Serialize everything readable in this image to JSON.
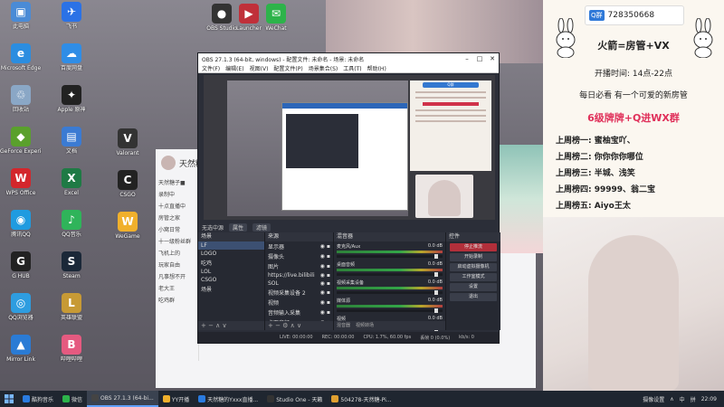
{
  "desktop": {
    "icons": [
      {
        "label": "此电脑",
        "color": "#4a8bd6",
        "glyph": "▣"
      },
      {
        "label": "Microsoft Edge",
        "color": "#2b8de0",
        "glyph": "e"
      },
      {
        "label": "回收站",
        "color": "#8aa7c6",
        "glyph": "♲"
      },
      {
        "label": "GeForce Experience",
        "color": "#5aa02c",
        "glyph": "◆"
      },
      {
        "label": "WPS Office",
        "color": "#d3262c",
        "glyph": "W"
      },
      {
        "label": "腾讯QQ",
        "color": "#1f9be0",
        "glyph": "◉"
      },
      {
        "label": "G HUB",
        "color": "#222",
        "glyph": "G"
      },
      {
        "label": "QQ浏览器",
        "color": "#2e9de0",
        "glyph": "◎"
      },
      {
        "label": "Mirror Link",
        "color": "#2a7bd5",
        "glyph": "▲"
      },
      {
        "label": "飞书",
        "color": "#2b72e6",
        "glyph": "✈"
      },
      {
        "label": "百度网盘",
        "color": "#2f8de6",
        "glyph": "☁"
      },
      {
        "label": "Apple 原神",
        "color": "#222",
        "glyph": "✦"
      },
      {
        "label": "文档",
        "color": "#3b7bd3",
        "glyph": "▤"
      },
      {
        "label": "Excel",
        "color": "#1f7a45",
        "glyph": "X"
      },
      {
        "label": "QQ音乐",
        "color": "#2fb45a",
        "glyph": "♪"
      },
      {
        "label": "Steam",
        "color": "#1b2838",
        "glyph": "S"
      },
      {
        "label": "英雄联盟",
        "color": "#c79a35",
        "glyph": "L"
      },
      {
        "label": "哔哩哔哩",
        "color": "#e55a80",
        "glyph": "B"
      },
      {
        "label": "Valorant",
        "color": "#333",
        "glyph": "V"
      },
      {
        "label": "CSGO",
        "color": "#222",
        "glyph": "C"
      },
      {
        "label": "WeGame",
        "color": "#f0b02c",
        "glyph": "W"
      },
      {
        "label": "OBS Studio",
        "color": "#333",
        "glyph": "●"
      },
      {
        "label": "Launcher",
        "color": "#c0303a",
        "glyph": "▶"
      },
      {
        "label": "WeChat",
        "color": "#2db34a",
        "glyph": "✉"
      }
    ]
  },
  "bgapp": {
    "title": "天然糖",
    "items": [
      "天然糖子■",
      "录制中",
      "十点直播中",
      "房管之家",
      "小窝日常",
      "十一级粉丝群",
      "飞机上的",
      "玩家自由",
      "凡事想不开",
      "老大王",
      "吃鸡群"
    ]
  },
  "obs": {
    "title": "OBS 27.1.3 (64-bit, windows) - 配置文件: 未命名 - 场景: 未命名",
    "menu": [
      "文件(F)",
      "编辑(E)",
      "视图(V)",
      "配置文件(P)",
      "场景集合(S)",
      "工具(T)",
      "帮助(H)"
    ],
    "status_row": {
      "label": "无选中源",
      "props": "属性",
      "filters": "滤镜"
    },
    "docks": {
      "scenes": "场景",
      "sources": "来源",
      "mixer": "混音器",
      "transitions": "转场",
      "controls": "控件"
    },
    "scenes": [
      "LF",
      "LOGO",
      "吃鸡",
      "LOL",
      "CSGO",
      "场景"
    ],
    "sources": [
      "显示器",
      "摄像头",
      "图片",
      "https://live.bilibili",
      "SOL",
      "视频采集设备 2",
      "视频",
      "音频输入采集",
      "桌面音频"
    ],
    "mixer": [
      {
        "name": "麦克风/Aux",
        "db": "0.0 dB"
      },
      {
        "name": "桌面音频",
        "db": "0.0 dB"
      },
      {
        "name": "视频采集设备",
        "db": "0.0 dB"
      },
      {
        "name": "媒体源",
        "db": "0.0 dB"
      },
      {
        "name": "视频",
        "db": "0.0 dB"
      }
    ],
    "mixer_tabs": [
      "混音器",
      "视频转场"
    ],
    "controls": [
      {
        "label": "停止推流",
        "red": true
      },
      {
        "label": "开始录制",
        "red": false
      },
      {
        "label": "启动虚拟摄像机",
        "red": false
      },
      {
        "label": "工作室模式",
        "red": false
      },
      {
        "label": "设置",
        "red": false
      },
      {
        "label": "退出",
        "red": false
      }
    ],
    "bottom": {
      "live": "LIVE: 00:00:00",
      "rec": "REC: 00:00:00",
      "cpu": "CPU: 1.7%, 60.00 fps",
      "dropped": "丢帧 0 (0.0%)",
      "kbps": "kb/s: 0"
    }
  },
  "right_panel": {
    "qq_badge": "Q群",
    "qq_number": "728350668",
    "title": "火箭=房管+VX",
    "hours": "开播时间: 14点-22点",
    "daily": "每日必看 有一个可爱的新房管",
    "highlight": "6级牌牌+Q进WX群",
    "ranks": [
      "上周榜一: 蜜柚宝吖、",
      "上周榜二: 你你你你哪位",
      "上周榜三: 半城、浅笑",
      "上周榜四: 99999、翁二宝",
      "上周榜五: Aiyo王太"
    ]
  },
  "taskbar": {
    "items": [
      {
        "label": "酷狗音乐",
        "color": "#2a7be0",
        "active": false
      },
      {
        "label": "微信",
        "color": "#2db34a",
        "active": false
      },
      {
        "label": "OBS 27.1.3 (64-bi...",
        "color": "#444",
        "active": true
      },
      {
        "label": "YY开播",
        "color": "#f0b02c",
        "active": false
      },
      {
        "label": "天然糖的Yxxx直播...",
        "color": "#2a7be0",
        "active": false
      },
      {
        "label": "Studio One - 天籁",
        "color": "#333",
        "active": false
      },
      {
        "label": "504278-天然糖-Pi...",
        "color": "#e0a030",
        "active": false
      }
    ],
    "tray": [
      "摄像设置",
      "∧",
      "中",
      "拼"
    ],
    "time": "22:09"
  },
  "colors": {
    "accent_red": "#e0305a",
    "obs_bg": "#2b2e38",
    "taskbar": "#1f2630"
  }
}
